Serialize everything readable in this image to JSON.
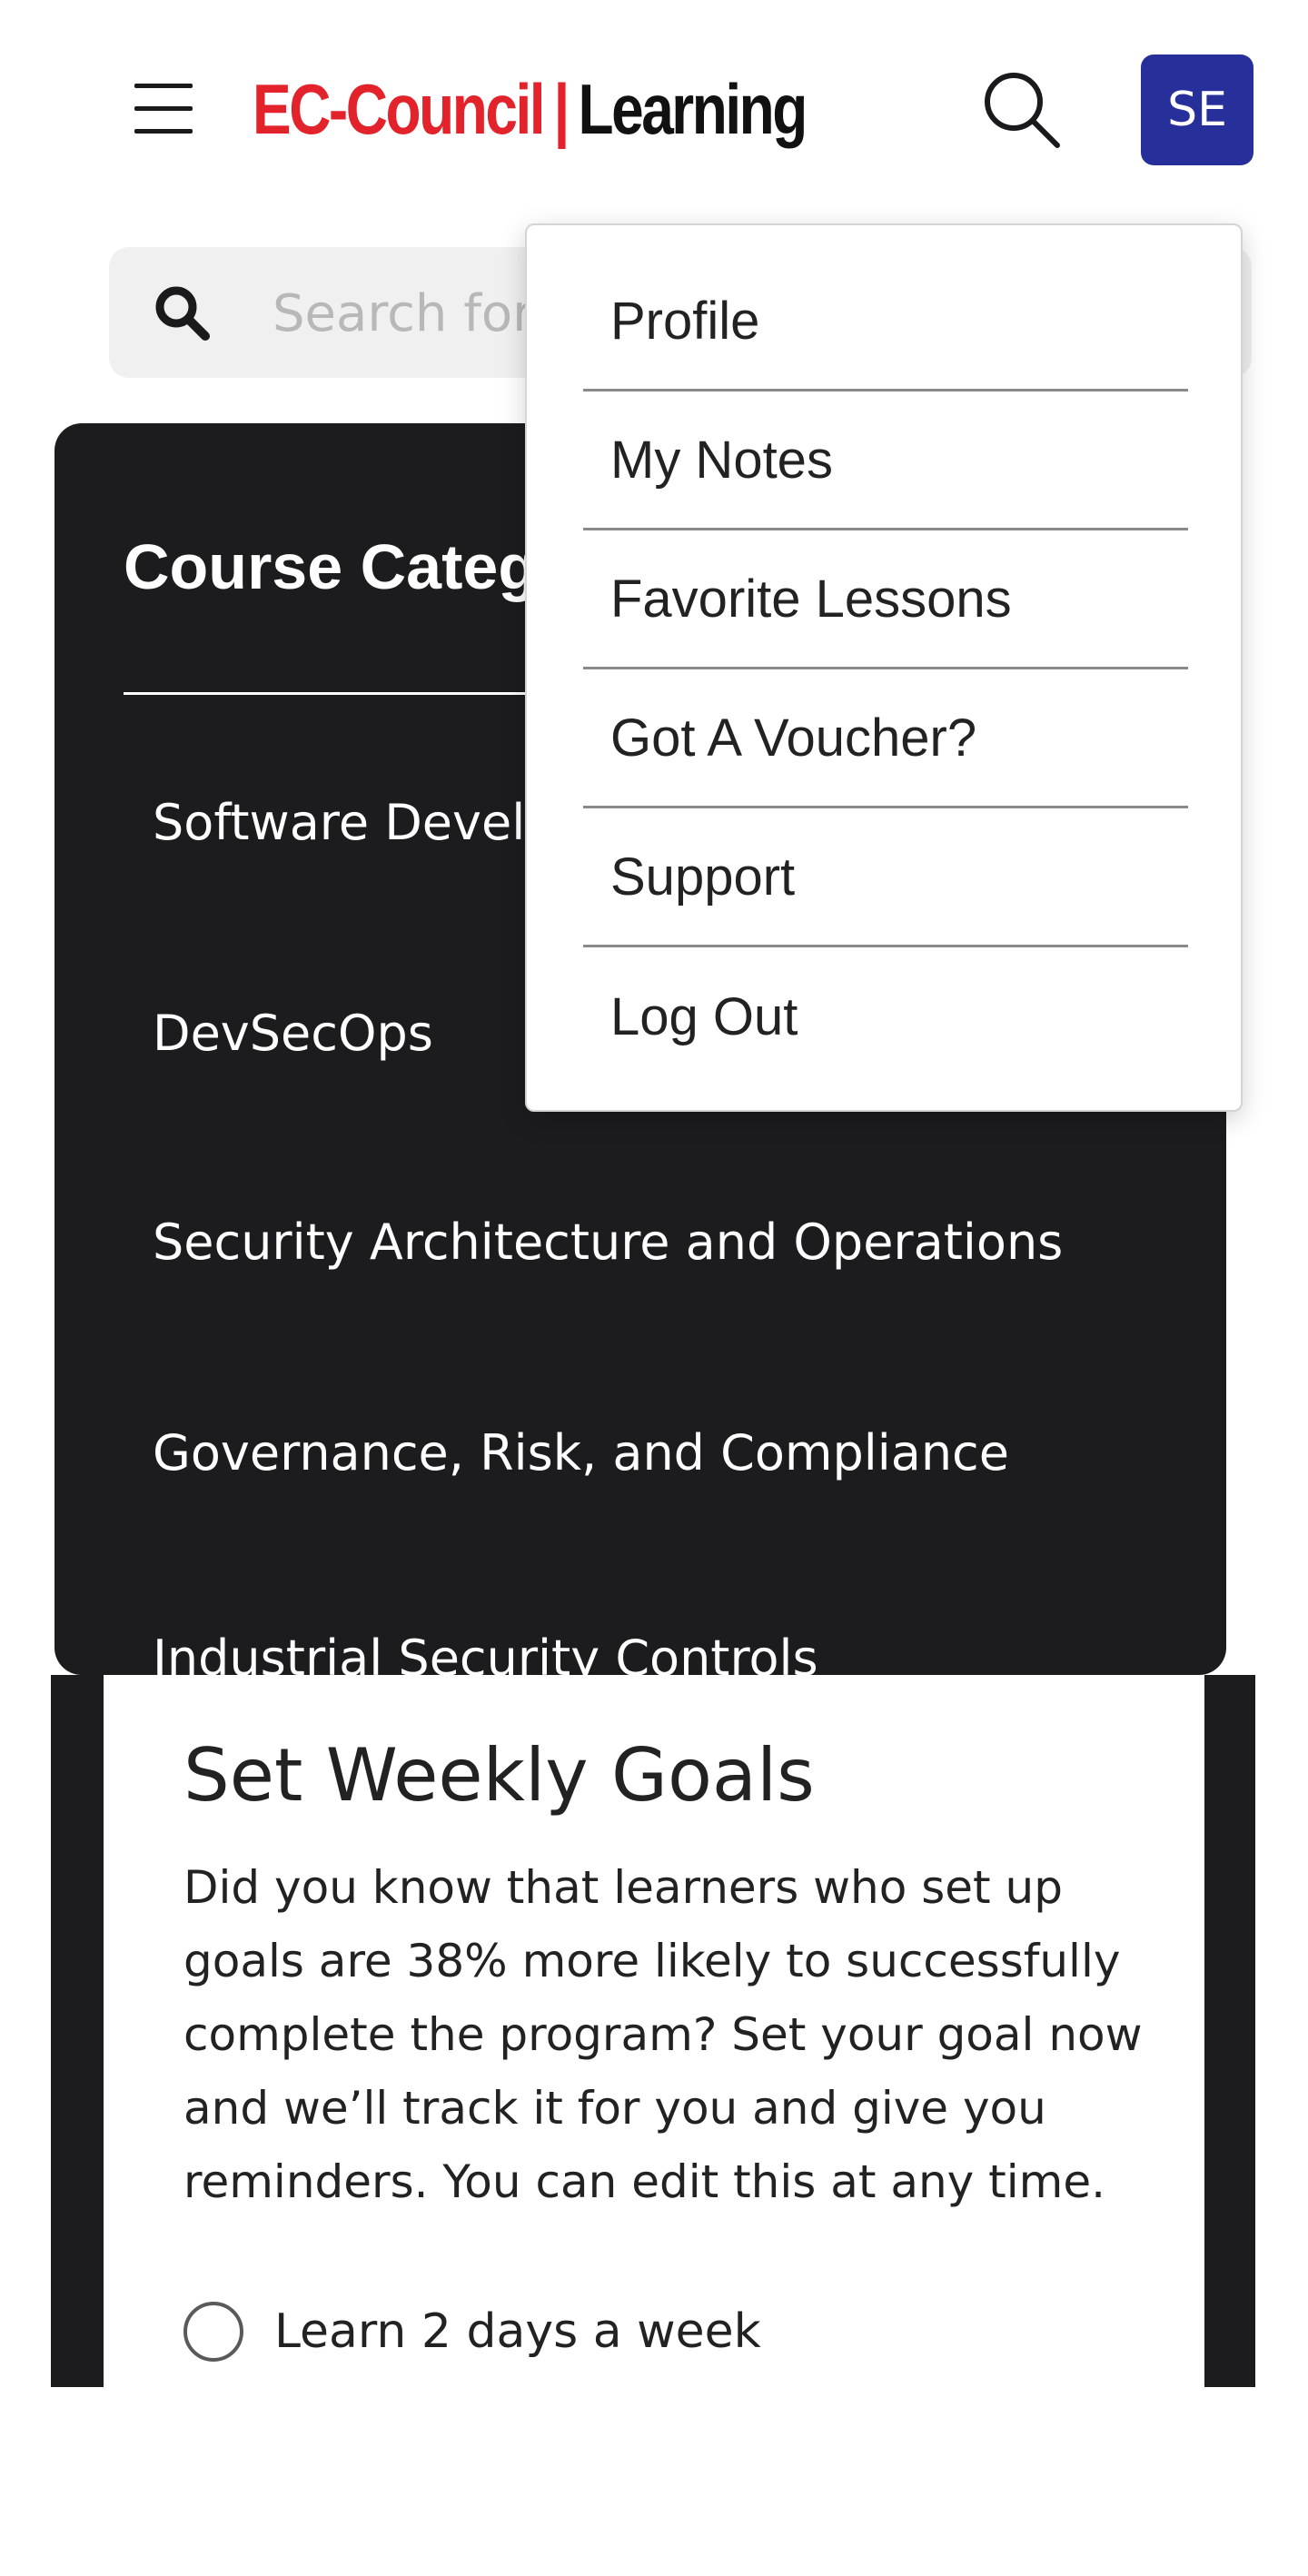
{
  "header": {
    "logo": {
      "brand": "EC-Council",
      "separator": "|",
      "product": "Learning"
    },
    "avatar_initials": "SE",
    "avatar_color": "#27309a",
    "brand_color": "#e3232b"
  },
  "search": {
    "placeholder": "Search for",
    "value": ""
  },
  "categories": {
    "title": "Course Categories",
    "items": [
      "Software Development",
      "DevSecOps",
      "Security Architecture and Operations",
      "Governance, Risk, and Compliance",
      "Industrial Security Controls"
    ]
  },
  "weekly_goals": {
    "title": "Set Weekly Goals",
    "description": "Did you know that learners who set up goals are 38% more likely to successfully complete the program? Set your goal now and we’ll track it for you and give you reminders. You can edit this at any time.",
    "options": [
      "Learn 2 days a week"
    ]
  },
  "profile_menu": {
    "items": [
      "Profile",
      "My Notes",
      "Favorite Lessons",
      "Got A Voucher?",
      "Support",
      "Log Out"
    ]
  }
}
